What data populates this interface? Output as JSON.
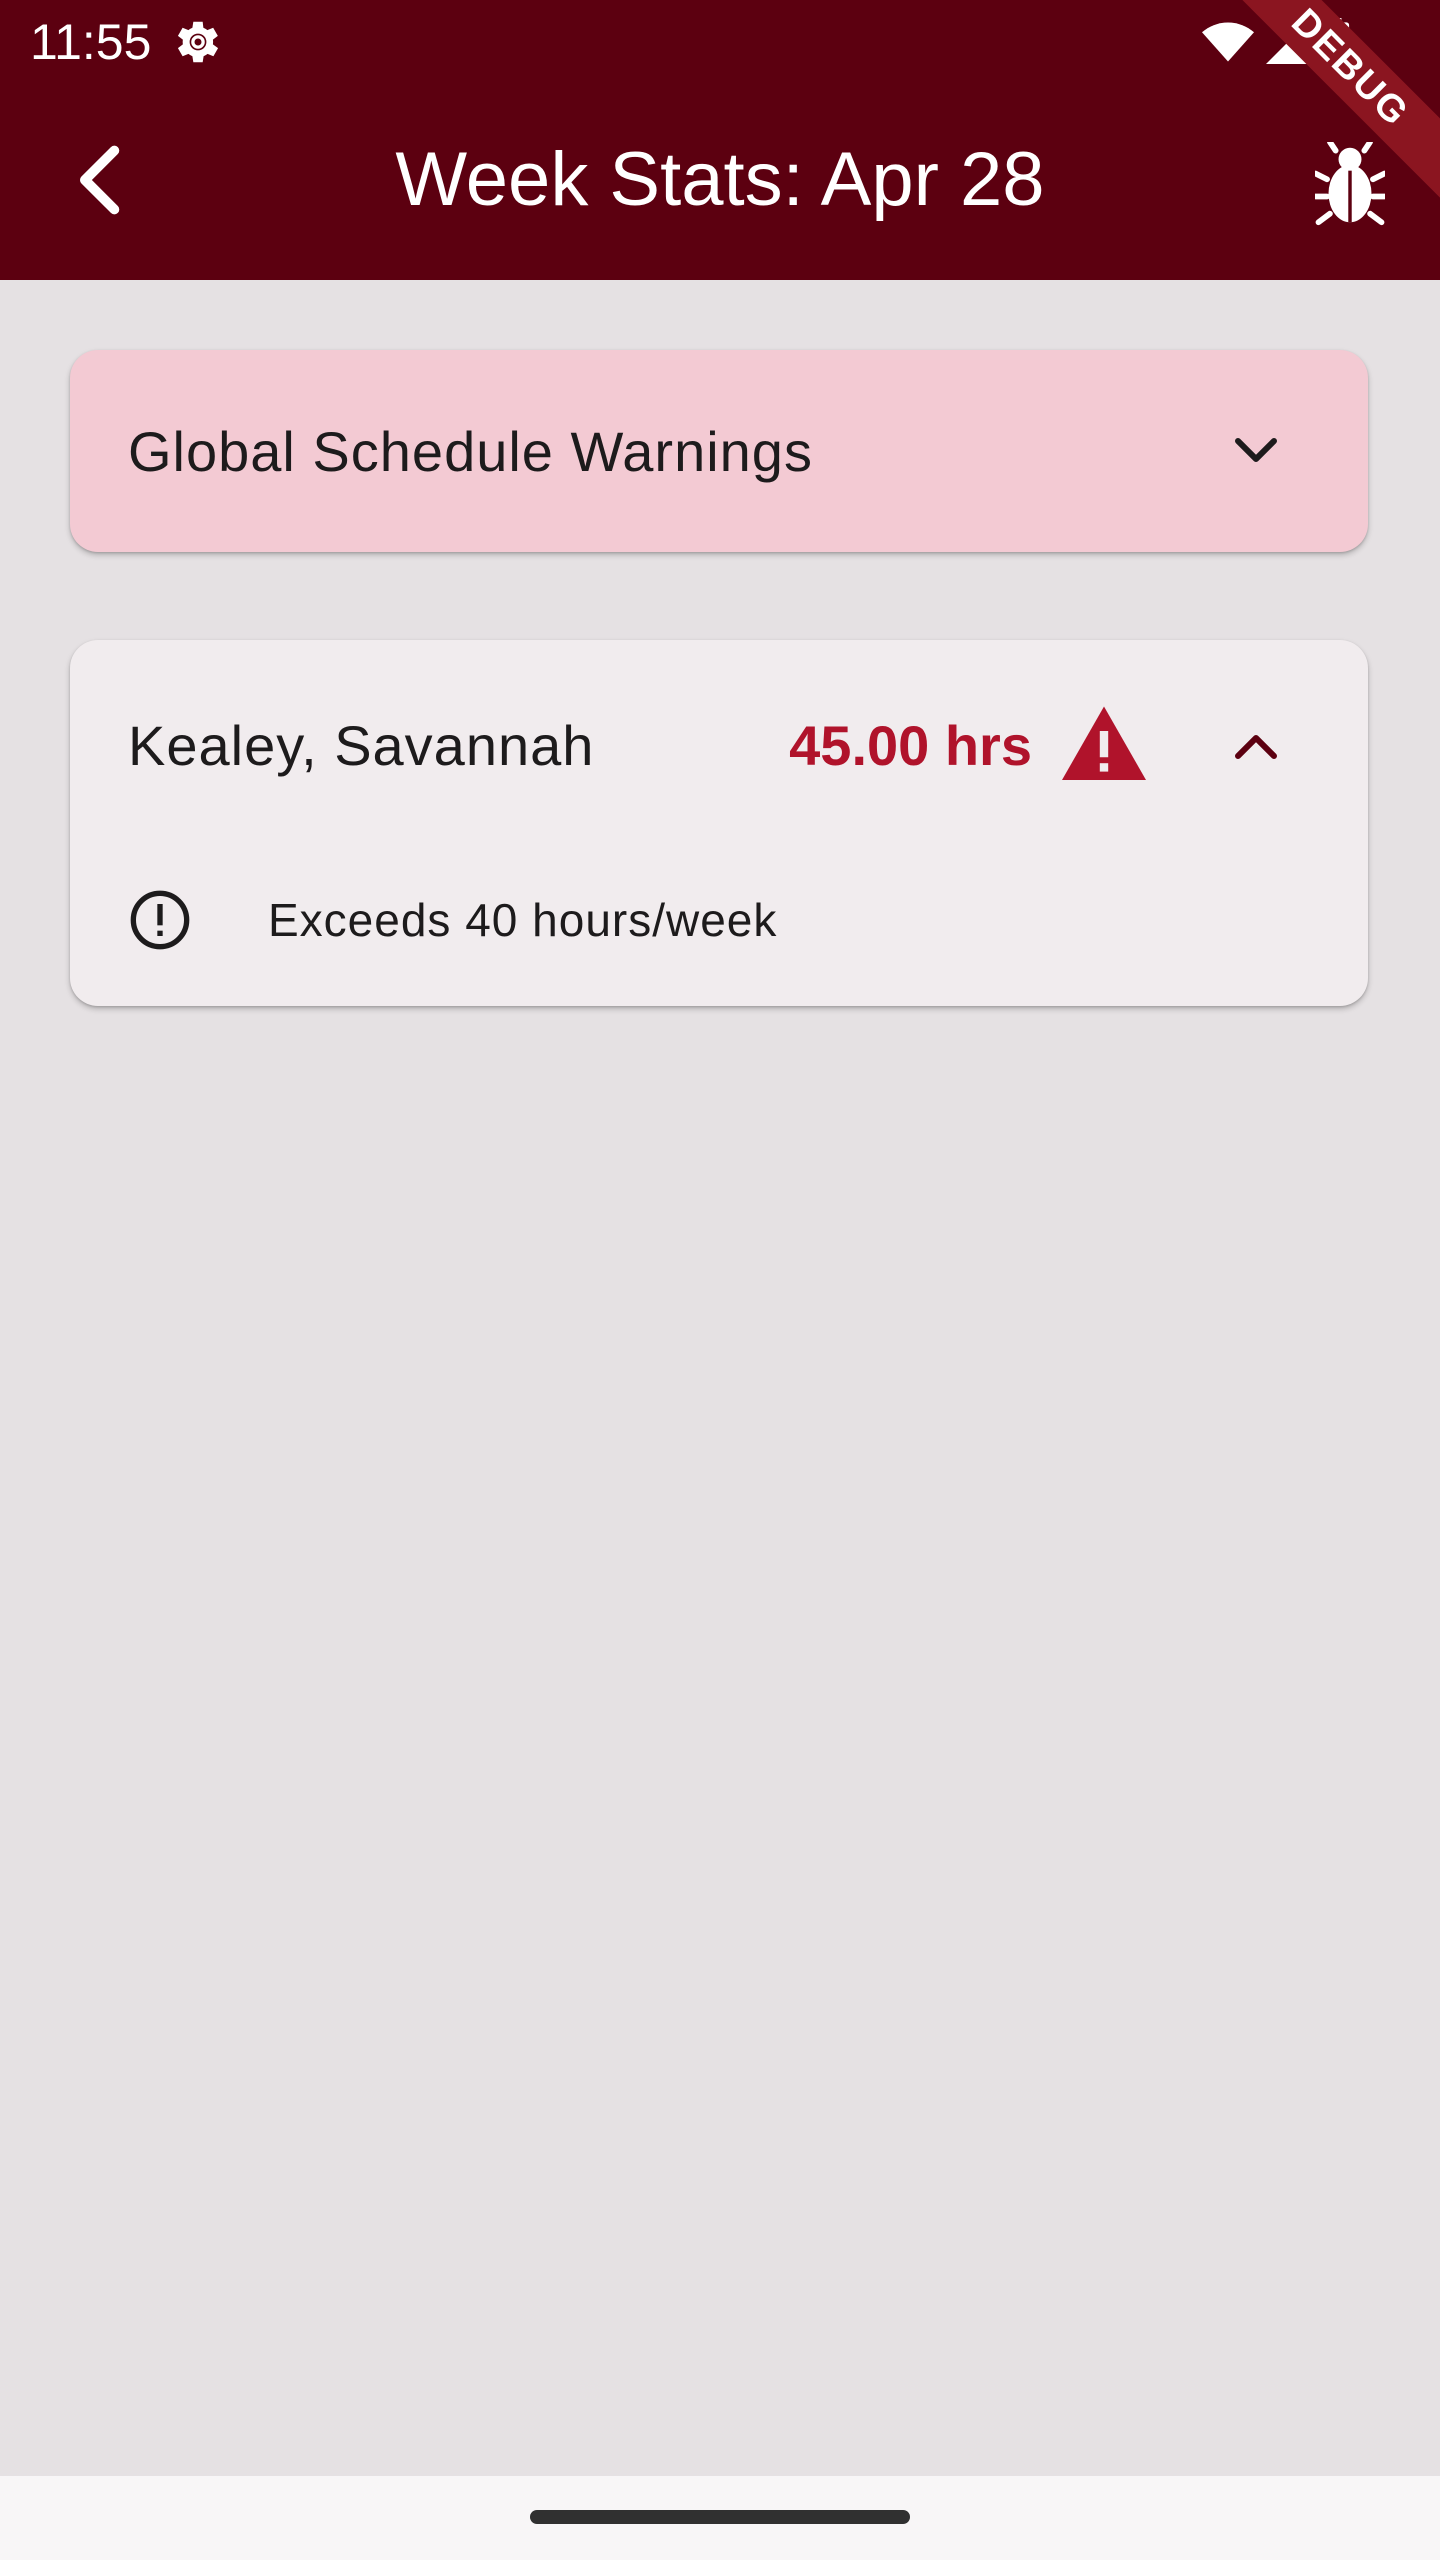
{
  "status_bar": {
    "time": "11:55",
    "icons": [
      "settings-gear-icon",
      "wifi-icon",
      "signal-icon",
      "battery-icon"
    ]
  },
  "app_bar": {
    "title": "Week Stats: Apr 28",
    "back_icon": "chevron-left-icon",
    "action_icon": "bug-icon",
    "background": "#5c0010"
  },
  "debug_banner": {
    "label": "DEBUG"
  },
  "global_warnings": {
    "title": "Global Schedule Warnings",
    "expanded": false,
    "background": "#f3cad3"
  },
  "employees": [
    {
      "name": "Kealey, Savannah",
      "hours": "45.00 hrs",
      "status_icon": "warning-triangle-icon",
      "expanded": true,
      "warnings": [
        {
          "icon": "exclamation-circle-icon",
          "text": "Exceeds 40 hours/week"
        }
      ]
    }
  ],
  "colors": {
    "accent": "#b0132b",
    "background": "#e5e1e3",
    "card": "#f1ecee"
  }
}
